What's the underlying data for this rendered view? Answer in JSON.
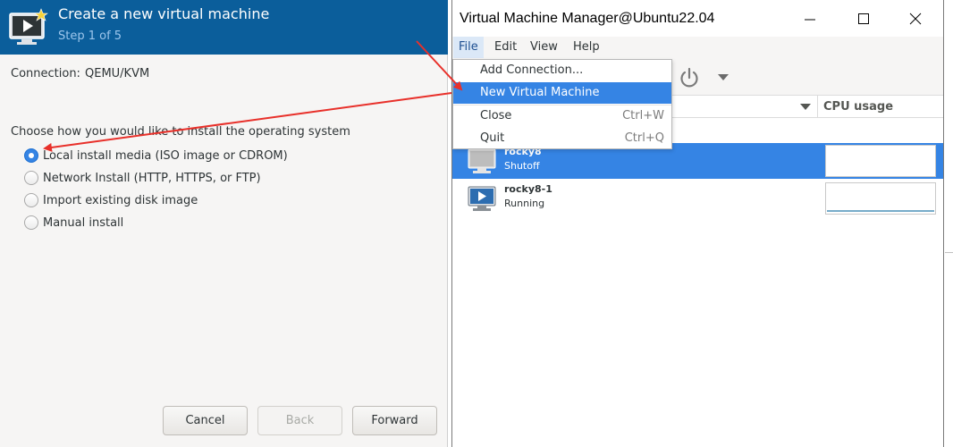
{
  "wizard": {
    "title": "Create a new virtual machine",
    "step": "Step 1 of 5",
    "connection_label": "Connection:",
    "connection_value": "QEMU/KVM",
    "prompt": "Choose how you would like to install the operating system",
    "options": [
      {
        "label": "Local install media (ISO image or CDROM)",
        "selected": true
      },
      {
        "label": "Network Install (HTTP, HTTPS, or FTP)",
        "selected": false
      },
      {
        "label": "Import existing disk image",
        "selected": false
      },
      {
        "label": "Manual install",
        "selected": false
      }
    ],
    "buttons": {
      "cancel": "Cancel",
      "back": "Back",
      "forward": "Forward"
    },
    "header_color": "#0b5e9b"
  },
  "vmm": {
    "title": "Virtual Machine Manager@Ubuntu22.04",
    "menu": [
      "File",
      "Edit",
      "View",
      "Help"
    ],
    "file_menu": [
      {
        "label": "Add Connection...",
        "accel": ""
      },
      {
        "label": "New Virtual Machine",
        "accel": "",
        "highlighted": true
      },
      {
        "label": "Close",
        "accel": "Ctrl+W"
      },
      {
        "label": "Quit",
        "accel": "Ctrl+Q"
      }
    ],
    "columns": {
      "cpu": "CPU usage"
    },
    "vms": [
      {
        "name": "rocky8",
        "status": "Shutoff",
        "selected": true
      },
      {
        "name": "rocky8-1",
        "status": "Running",
        "selected": false
      }
    ],
    "icons": {
      "power": "power-icon",
      "dropdown": "chevron-down-icon",
      "minimize": "minimize-icon",
      "maximize": "maximize-icon",
      "close": "close-icon"
    },
    "selection_color": "#3584e4"
  },
  "annotations": {
    "arrow_color": "#e8302a"
  }
}
